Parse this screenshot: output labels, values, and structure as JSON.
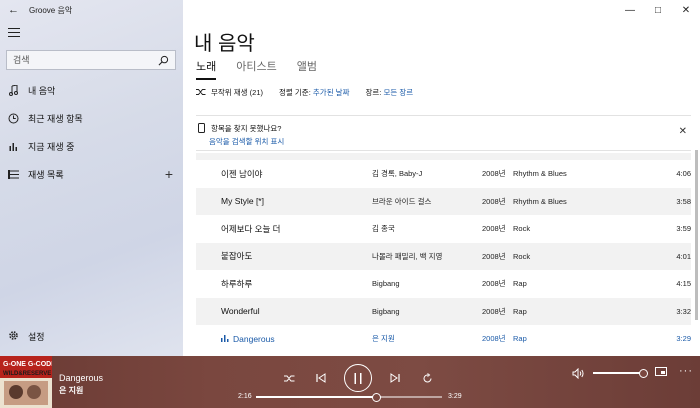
{
  "app": {
    "title": "Groove 음악"
  },
  "sidebar": {
    "search_placeholder": "검색",
    "items": [
      {
        "label": "내 음악",
        "icon": "music-note-icon"
      },
      {
        "label": "최근 재생 항목",
        "icon": "clock-icon"
      },
      {
        "label": "지금 재생 중",
        "icon": "bars-icon"
      },
      {
        "label": "재생 목록",
        "icon": "playlist-icon",
        "action": "+"
      }
    ],
    "settings_label": "설정"
  },
  "main": {
    "title": "내 음악",
    "tabs": [
      {
        "label": "노래",
        "active": true
      },
      {
        "label": "아티스트",
        "active": false
      },
      {
        "label": "앨범",
        "active": false
      }
    ],
    "toolbar": {
      "shuffle_label": "무작위 재생 (21)",
      "sort_label": "정렬 기준:",
      "sort_value": "추가된 날짜",
      "genre_label": "장르:",
      "genre_value": "모든 장르"
    },
    "notice": {
      "title": "항목을 찾지 못했나요?",
      "link": "음악을 검색할 위치 표시"
    },
    "tracks": [
      {
        "title": "이젠 남이야",
        "artist": "김 경록, Baby-J",
        "year": "2008년",
        "genre": "Rhythm & Blues",
        "duration": "4:06"
      },
      {
        "title": "My Style [*]",
        "artist": "브라운 아이드 걸스",
        "year": "2008년",
        "genre": "Rhythm & Blues",
        "duration": "3:58"
      },
      {
        "title": "어제보다 오늘 더",
        "artist": "김 종국",
        "year": "2008년",
        "genre": "Rock",
        "duration": "3:59"
      },
      {
        "title": "붙잡아도",
        "artist": "나몰라 패밀리, 백 지영",
        "year": "2008년",
        "genre": "Rock",
        "duration": "4:01"
      },
      {
        "title": "하루하루",
        "artist": "Bigbang",
        "year": "2008년",
        "genre": "Rap",
        "duration": "4:15"
      },
      {
        "title": "Wonderful",
        "artist": "Bigbang",
        "year": "2008년",
        "genre": "Rap",
        "duration": "3:32"
      },
      {
        "title": "Dangerous",
        "artist": "은 지원",
        "year": "2008년",
        "genre": "Rap",
        "duration": "3:29",
        "playing": true
      }
    ]
  },
  "player": {
    "album_art_text": "G-ONE & G-CODE WILD & RESERVE",
    "now_title": "Dangerous",
    "now_artist": "은 지원",
    "elapsed": "2:16",
    "total": "3:29",
    "progress_fraction": 0.65,
    "volume_fraction": 1.0
  },
  "colors": {
    "accent": "#1a5aa8",
    "player_bg": "#7a473f"
  }
}
